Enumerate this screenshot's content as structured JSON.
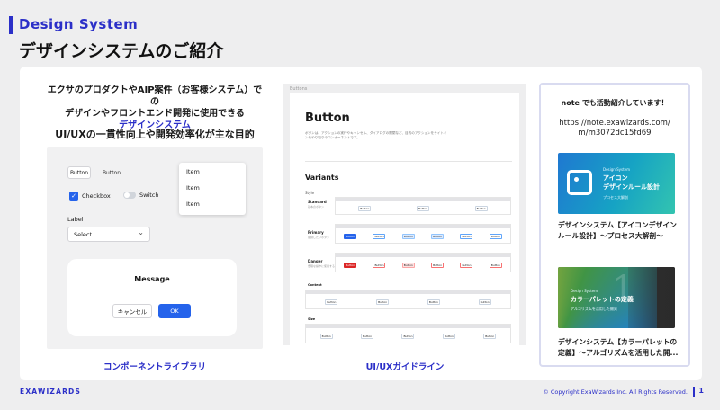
{
  "header": {
    "section_label": "Design System",
    "title": "デザインシステムのご紹介"
  },
  "left": {
    "intro_line1": "エクサのプロダクトやAIP案件（お客様システム）での",
    "intro_line2": "デザインやフロントエンド開発に使用できる",
    "intro_highlight": "デザインシステム",
    "goal": "UI/UXの一貫性向上や開発効率化が主な目的",
    "components": {
      "button_outline": "Button",
      "button_plain": "Button",
      "checkbox_label": "Checkbox",
      "switch_label": "Switch",
      "dropdown_items": [
        "Item",
        "Item",
        "Item"
      ],
      "select_label": "Label",
      "select_value": "Select",
      "dialog_title": "Message",
      "dialog_cancel": "キャンセル",
      "dialog_ok": "OK"
    },
    "caption": "コンポーネントライブラリ"
  },
  "middle": {
    "breadcrumb": "Buttons",
    "page_title": "Button",
    "description": "ボタンは、アクションの実行やキャンセル、ダイアログの開閉など、目的のアクションをサイトインをやり取りのコンポーネントです。",
    "variants_heading": "Variants",
    "style_label": "Style",
    "rows": [
      {
        "label": "Standard",
        "sub": "基本のボタン"
      },
      {
        "label": "Primary",
        "sub": "強調したいボタン"
      },
      {
        "label": "Danger",
        "sub": "危険な操作に使用するボタン"
      }
    ],
    "content_label": "Content",
    "size_label": "Size",
    "sample_button": "Button",
    "caption": "UI/UXガイドライン"
  },
  "right": {
    "heading": "note でも活動紹介しています！",
    "url_line1": "https://note.exawizards.com/",
    "url_line2": "m/m3072dc15fd69",
    "article1": {
      "thumb_small": "Design System",
      "thumb_title_line1": "アイコン",
      "thumb_title_line2": "デザインルール設計",
      "thumb_sub": "プロセス大解剖",
      "title": "デザインシステム【アイコンデザインルール設計】〜プロセス大解剖〜"
    },
    "article2": {
      "thumb_small": "Design System",
      "thumb_title": "カラーパレットの定義",
      "thumb_sub": "アルゴリズムを活用した開発",
      "title_line1": "デザインシステム【カラーパレットの",
      "title_line2": "定義】〜アルゴリズムを活用した開..."
    }
  },
  "footer": {
    "logo": "EXAWIZARDS",
    "copyright": "© Copyright ExaWizards Inc. All Rights Reserved.",
    "page": "1"
  },
  "colors": {
    "brand": "#2b2fc8",
    "primary_button": "#2563eb",
    "background": "#eeeeef"
  }
}
